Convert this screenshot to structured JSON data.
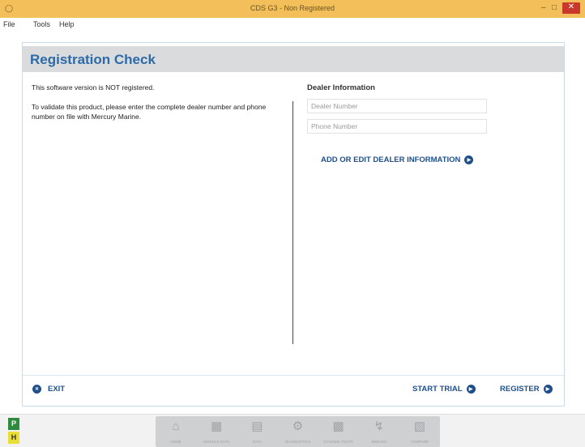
{
  "window": {
    "title": "CDS G3 - Non Registered"
  },
  "menubar": {
    "items": [
      "File",
      "Tools",
      "Help"
    ]
  },
  "panel": {
    "title": "Registration Check",
    "status_message": "This software version is NOT registered.",
    "instructions": "To validate this product, please enter the complete dealer number and phone number on file with Mercury Marine."
  },
  "dealer": {
    "heading": "Dealer Information",
    "dealer_number": {
      "value": "",
      "placeholder": "Dealer Number"
    },
    "phone_number": {
      "value": "",
      "placeholder": "Phone Number"
    },
    "add_edit_label": "ADD OR EDIT DEALER INFORMATION"
  },
  "footer": {
    "exit_label": "EXIT",
    "start_trial_label": "START TRIAL",
    "register_label": "REGISTER"
  },
  "side_badges": {
    "p": "P",
    "h": "H"
  },
  "dock": {
    "items": [
      {
        "label": "HOME",
        "icon": "home-icon"
      },
      {
        "label": "MODULE DATA",
        "icon": "module-data-icon"
      },
      {
        "label": "DATA",
        "icon": "data-icon"
      },
      {
        "label": "DIAGNOSTICS",
        "icon": "diagnostics-icon"
      },
      {
        "label": "DYNAMIC TESTS",
        "icon": "monitor-icon"
      },
      {
        "label": "BREAKS",
        "icon": "lightning-icon"
      },
      {
        "label": "COMPARE",
        "icon": "chart-icon"
      }
    ]
  },
  "colors": {
    "titlebar": "#f2bf5a",
    "accent_blue": "#1f4f8a",
    "title_blue": "#2d6aa6",
    "header_gray": "#d9dbdd",
    "close_red": "#c8382b",
    "badge_green": "#2e8b3e",
    "badge_yellow": "#e9de36"
  }
}
